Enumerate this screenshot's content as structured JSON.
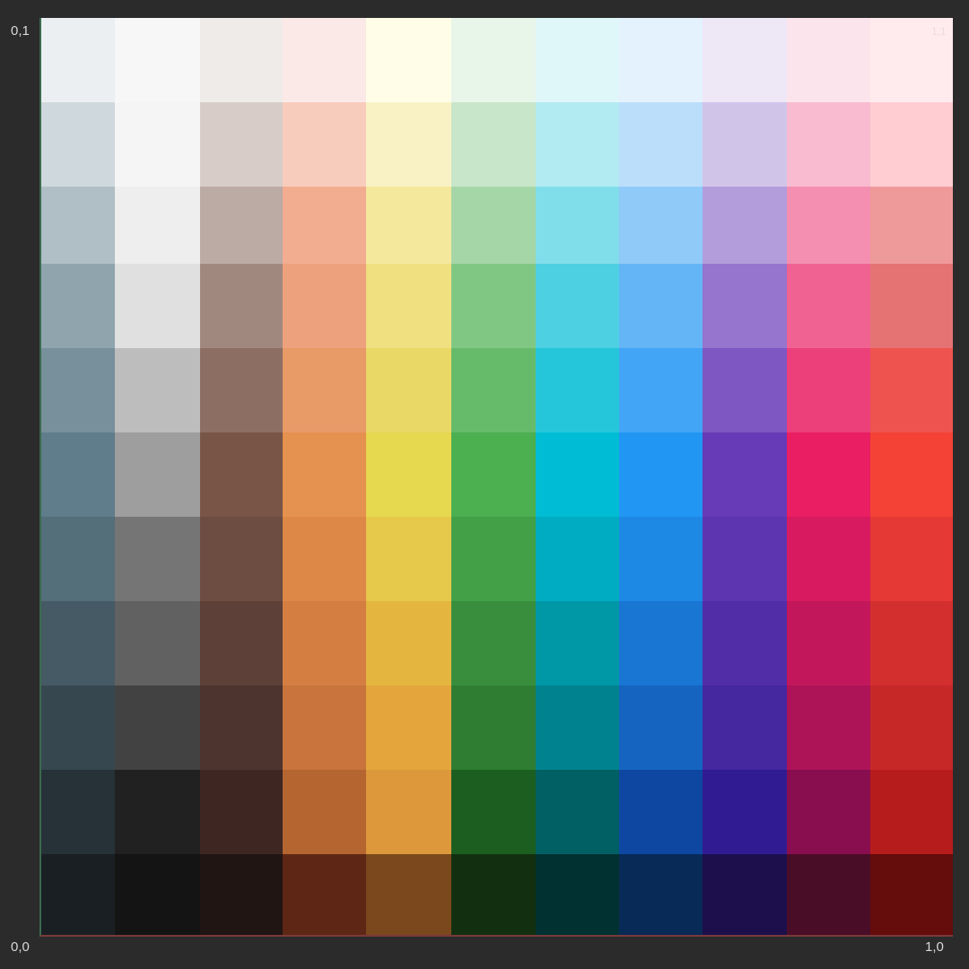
{
  "labels": {
    "origin": "0,0",
    "top_left": "0,1",
    "bottom_right": "1,0",
    "top_right": "1,1"
  },
  "palette": {
    "columns": [
      "blue-grey",
      "grey",
      "brown",
      "deep-orange",
      "yellow",
      "green",
      "cyan",
      "blue",
      "deep-purple",
      "pink",
      "red"
    ],
    "rows": [
      [
        "#eceff1",
        "#f7f7f7",
        "#efebe9",
        "#fbe9e7",
        "#fffde7",
        "#e8f5e9",
        "#e0f7fa",
        "#e3f2fd",
        "#ede7f6",
        "#fce4ec",
        "#ffebee"
      ],
      [
        "#cfd8dc",
        "#f5f5f5",
        "#d7ccc8",
        "#f8ccbc",
        "#f9f2c4",
        "#c8e6c9",
        "#b2ebf2",
        "#bbdefb",
        "#d1c4e9",
        "#f8bbd0",
        "#ffcdd2"
      ],
      [
        "#b0bec5",
        "#eeeeee",
        "#bcaaa4",
        "#f2ad91",
        "#f4e89d",
        "#a5d6a7",
        "#80deea",
        "#90caf9",
        "#b39ddb",
        "#f48fb1",
        "#ef9a9a"
      ],
      [
        "#90a4ae",
        "#e0e0e0",
        "#a1887f",
        "#eea17d",
        "#f0e080",
        "#81c784",
        "#4dd0e1",
        "#64b5f6",
        "#9575cd",
        "#f06292",
        "#e57373"
      ],
      [
        "#78909c",
        "#bdbdbd",
        "#8d6e63",
        "#e89a67",
        "#ead866",
        "#66bb6a",
        "#26c6da",
        "#42a5f5",
        "#7e57c2",
        "#ec407a",
        "#ef5350"
      ],
      [
        "#607d8b",
        "#9e9e9e",
        "#795548",
        "#e5914f",
        "#e6d84f",
        "#4caf50",
        "#00bcd4",
        "#2196f3",
        "#673ab7",
        "#e91e63",
        "#f44336"
      ],
      [
        "#546e7a",
        "#757575",
        "#6d4c41",
        "#de8848",
        "#e6c84a",
        "#43a047",
        "#00acc1",
        "#1e88e5",
        "#5e35b1",
        "#d81b60",
        "#e53935"
      ],
      [
        "#455a64",
        "#616161",
        "#5d4037",
        "#d47e42",
        "#e4b640",
        "#388e3c",
        "#0097a7",
        "#1976d2",
        "#512da8",
        "#c2185b",
        "#d32f2f"
      ],
      [
        "#37474f",
        "#424242",
        "#4e342e",
        "#c8743c",
        "#e4a63c",
        "#2e7d32",
        "#00838f",
        "#1565c0",
        "#4527a0",
        "#ad1457",
        "#c62828"
      ],
      [
        "#263238",
        "#212121",
        "#3e2723",
        "#b56530",
        "#dc983b",
        "#1b5e20",
        "#006064",
        "#0d47a1",
        "#311b92",
        "#880e4f",
        "#b71c1c"
      ],
      [
        "#1a1f24",
        "#141414",
        "#211514",
        "#5e2715",
        "#7a481c",
        "#12300f",
        "#023132",
        "#082a57",
        "#1c0f4c",
        "#4a0d28",
        "#650c0c"
      ]
    ]
  }
}
